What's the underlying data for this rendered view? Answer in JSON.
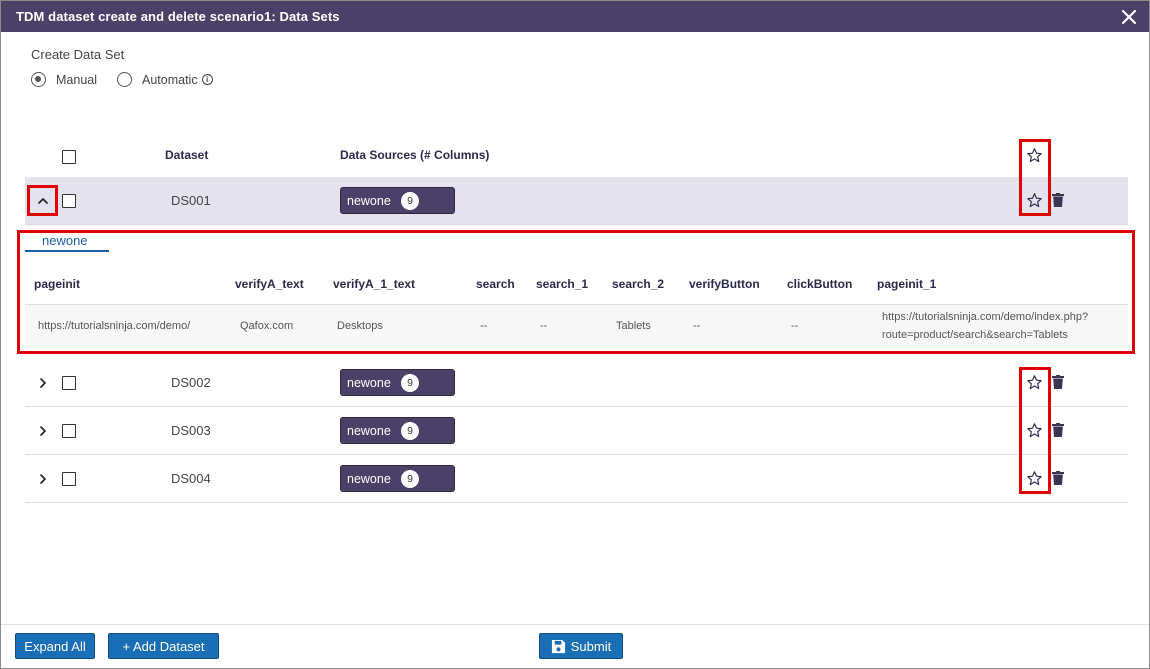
{
  "window": {
    "title": "TDM dataset create and delete scenario1: Data Sets"
  },
  "create": {
    "label": "Create Data Set",
    "options": [
      "Manual",
      "Automatic"
    ],
    "selected": "Manual"
  },
  "table": {
    "headers": {
      "dataset": "Dataset",
      "sources": "Data Sources (# Columns)"
    },
    "rows": [
      {
        "name": "DS001",
        "source": "newone",
        "count": "9",
        "expanded": true
      },
      {
        "name": "DS002",
        "source": "newone",
        "count": "9",
        "expanded": false
      },
      {
        "name": "DS003",
        "source": "newone",
        "count": "9",
        "expanded": false
      },
      {
        "name": "DS004",
        "source": "newone",
        "count": "9",
        "expanded": false
      }
    ]
  },
  "detail": {
    "tab": "newone",
    "columns": [
      "pageinit",
      "verifyA_text",
      "verifyA_1_text",
      "search",
      "search_1",
      "search_2",
      "verifyButton",
      "clickButton",
      "pageinit_1"
    ],
    "values": [
      "https://tutorialsninja.com/demo/",
      "Qafox.com",
      "Desktops",
      "--",
      "--",
      "Tablets",
      "--",
      "--",
      "https://tutorialsninja.com/demo/index.php?",
      "route=product/search&search=Tablets"
    ]
  },
  "footer": {
    "expand_all": "Expand All",
    "add_dataset": "+ Add Dataset",
    "submit": "Submit"
  },
  "colors": {
    "header": "#4b4168",
    "button": "#1a6eb5",
    "highlight": "#e00000"
  },
  "icons": [
    "close-icon",
    "star-icon",
    "trash-icon",
    "chevron-up-icon",
    "chevron-right-icon",
    "save-icon",
    "info-icon"
  ]
}
